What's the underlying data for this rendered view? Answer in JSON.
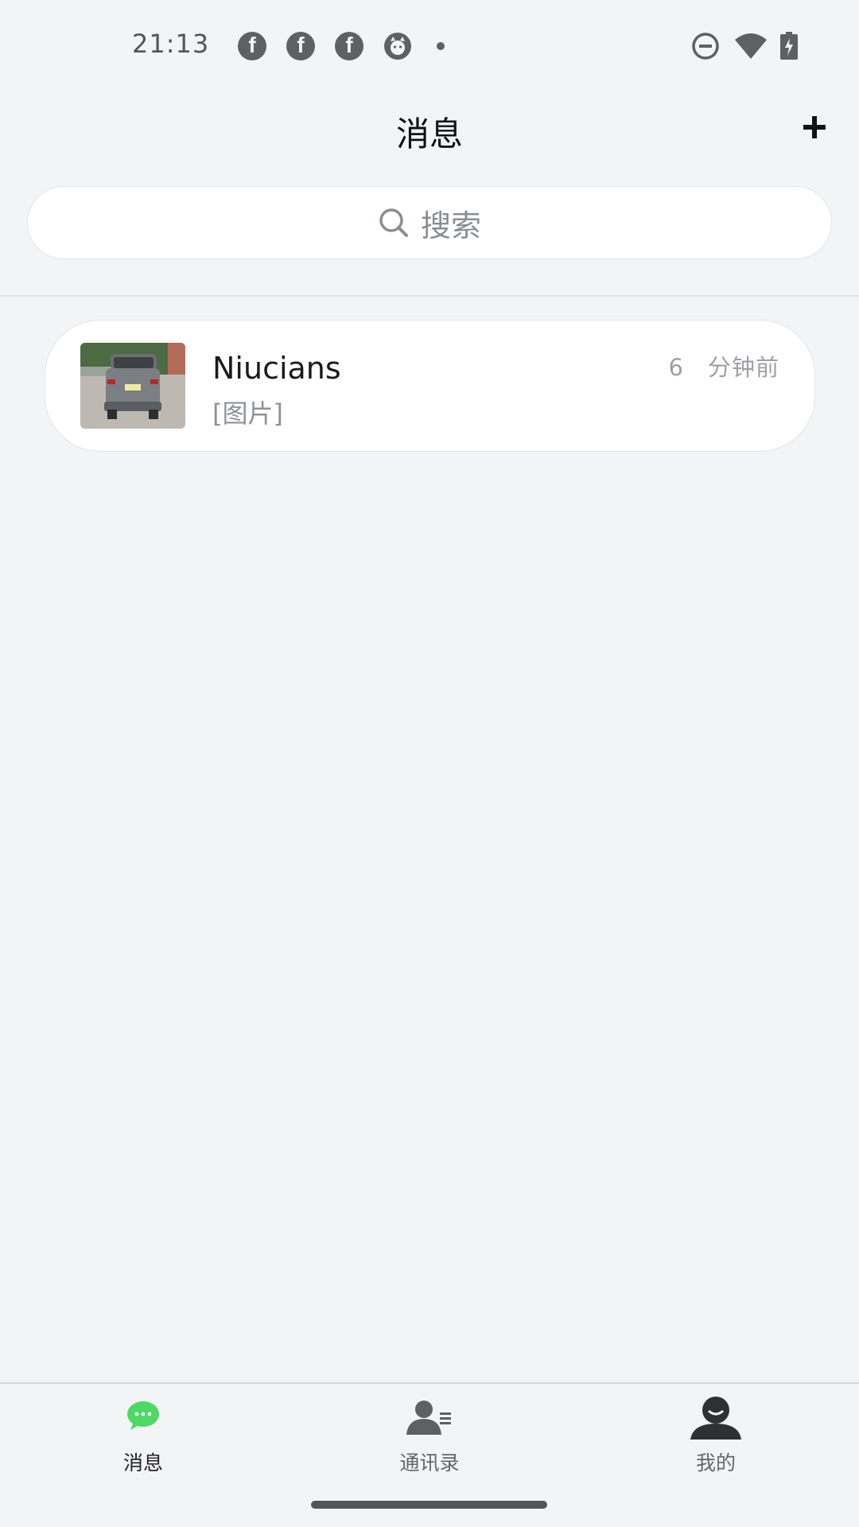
{
  "status_bar": {
    "time": "21:13",
    "icons": [
      "facebook-icon",
      "facebook-icon",
      "facebook-icon",
      "cat-app-icon",
      "dot-icon",
      "do-not-disturb-icon",
      "wifi-icon",
      "battery-charging-icon"
    ]
  },
  "header": {
    "title": "消息",
    "add_icon": "plus-icon"
  },
  "search": {
    "placeholder": "搜索",
    "icon": "search-icon"
  },
  "conversations": [
    {
      "name": "Niucians",
      "preview": "[图片]",
      "time": "6　分钟前",
      "avatar": "car-photo"
    }
  ],
  "bottom_nav": {
    "items": [
      {
        "label": "消息",
        "icon": "chat-bubble-icon",
        "active": true
      },
      {
        "label": "通讯录",
        "icon": "contacts-icon",
        "active": false
      },
      {
        "label": "我的",
        "icon": "profile-icon",
        "active": false
      }
    ]
  },
  "colors": {
    "background": "#f3f4f6",
    "accent_green": "#4cd964",
    "text_primary": "#111111",
    "text_secondary": "#8e9199"
  }
}
